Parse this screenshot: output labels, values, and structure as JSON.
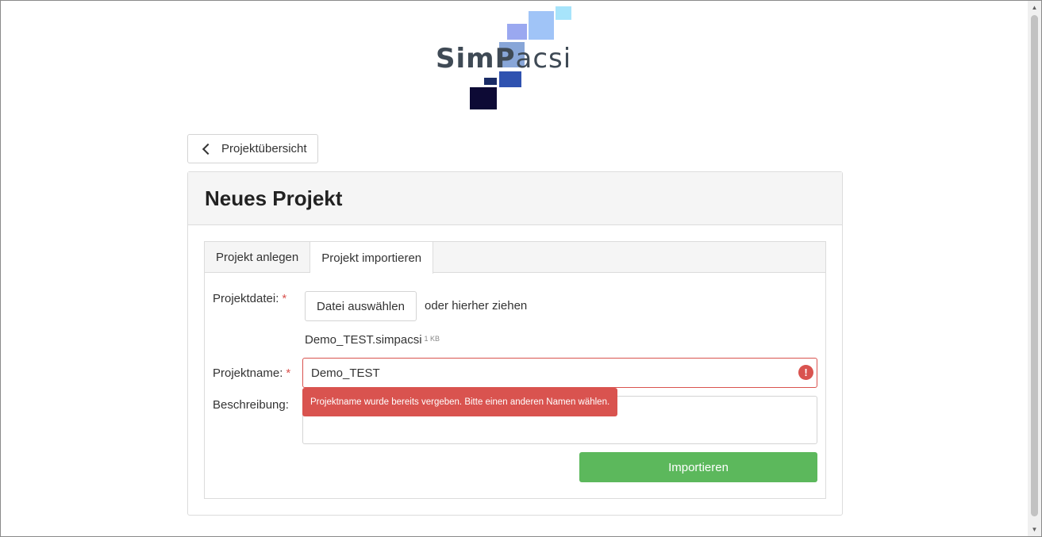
{
  "logo": {
    "text_bold": "SimP",
    "text_light": "acsi",
    "colors": [
      "#a7e4fb",
      "#a0c4f7",
      "#9aa8f0",
      "#2f52b0",
      "#1a2c66",
      "#0d0a35"
    ]
  },
  "nav": {
    "back_label": "Projektübersicht",
    "back_icon": "chevron-left-icon"
  },
  "panel": {
    "title": "Neues Projekt"
  },
  "tabs": [
    {
      "label": "Projekt anlegen",
      "active": false
    },
    {
      "label": "Projekt importieren",
      "active": true
    }
  ],
  "form": {
    "file_label": "Projektdatei:",
    "required_marker": "*",
    "file_button_label": "Datei auswählen",
    "drop_hint": "oder hierher ziehen",
    "file_name": "Demo_TEST.simpacsi",
    "file_size": "1 KB",
    "name_label": "Projektname:",
    "name_value": "Demo_TEST",
    "name_error_icon": "exclamation-circle-icon",
    "name_error": "Projektname wurde bereits vergeben. Bitte einen anderen Namen wählen.",
    "description_label": "Beschreibung:",
    "description_value": "",
    "submit_label": "Importieren"
  },
  "colors": {
    "error": "#d9534f",
    "success": "#5cb85c",
    "panel_header_bg": "#f5f5f5"
  }
}
